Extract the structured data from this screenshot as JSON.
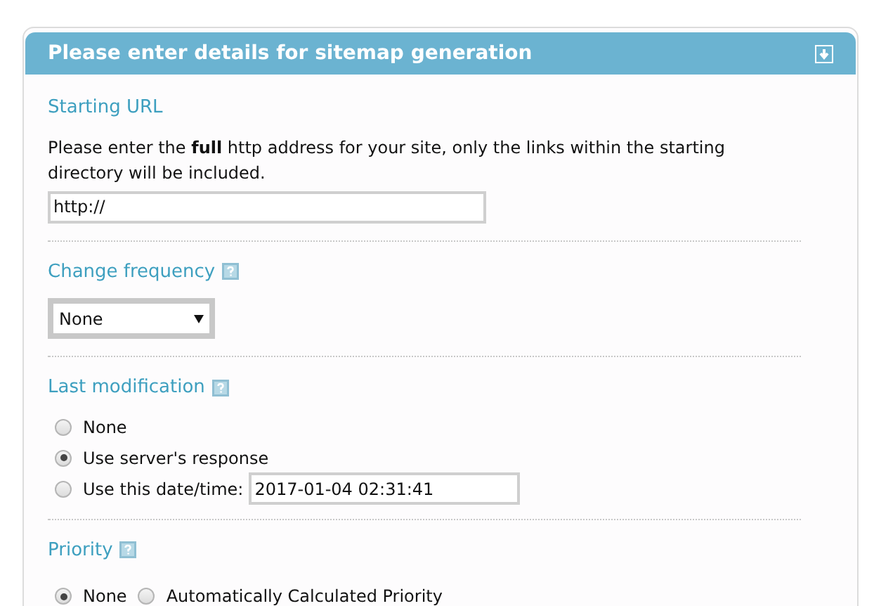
{
  "panel": {
    "title": "Please enter details for sitemap generation"
  },
  "starting_url": {
    "heading": "Starting URL",
    "description": "Please enter the **full** http address for your site, only the links within the starting directory will be included.",
    "value": "http://"
  },
  "change_frequency": {
    "heading": "Change frequency",
    "value": "None"
  },
  "last_modification": {
    "heading": "Last modification",
    "options": [
      {
        "label": "None",
        "selected": false
      },
      {
        "label": "Use server's response",
        "selected": true
      },
      {
        "label": "Use this date/time:",
        "selected": false,
        "value": "2017-01-04 02:31:41"
      }
    ]
  },
  "priority": {
    "heading": "Priority",
    "options": [
      {
        "label": "None",
        "selected": true
      },
      {
        "label": "Automatically Calculated Priority",
        "selected": false
      }
    ]
  }
}
